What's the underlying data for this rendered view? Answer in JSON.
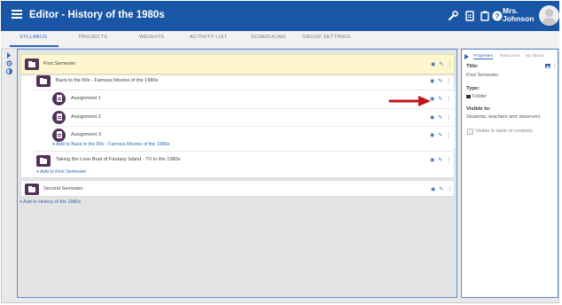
{
  "header": {
    "title": "Editor - History of the 1980s",
    "user_name_line1": "Mrs.",
    "user_name_line2": "Johnson",
    "icons": [
      "wrench-icon",
      "document-icon",
      "clipboard-icon",
      "help-icon"
    ]
  },
  "tabs": [
    {
      "label": "SYLLABUS",
      "active": true
    },
    {
      "label": "PROJECTS",
      "active": false
    },
    {
      "label": "WEIGHTS",
      "active": false
    },
    {
      "label": "ACTIVITY LIST",
      "active": false
    },
    {
      "label": "SCHEDULING",
      "active": false
    },
    {
      "label": "GROUP SETTINGS",
      "active": false
    }
  ],
  "syllabus": {
    "first_semester": "First Semester",
    "back_to_80s": "Back to the 80s - Famous Movies of the 1980s",
    "assignments": [
      "Assignment 1",
      "Assignment 2",
      "Assignment 3"
    ],
    "add_to_back_to_80s": "Add to Back to the 80s - Famous Movies of the 1980s",
    "love_boat": "Taking the Love Boat of Fantasy Island - TV in the 1980s",
    "add_to_first_semester": "Add to First Semester",
    "second_semester": "Second Semester",
    "add_to_history": "Add to History of the 1980s"
  },
  "properties": {
    "tabs": [
      "Properties",
      "Resources",
      "My library"
    ],
    "title_label": "Title:",
    "title_value": "First Semester",
    "type_label": "Type:",
    "type_value": "Folder",
    "visible_label": "Visible to:",
    "visible_value": "Students, teachers and observers",
    "toc_label": "Visible in table of contents"
  },
  "colors": {
    "header": "#1a56a6",
    "accent": "#2e67b8",
    "badge": "#533259",
    "selected_row": "#fdf6cf",
    "arrow": "#c0151a"
  }
}
